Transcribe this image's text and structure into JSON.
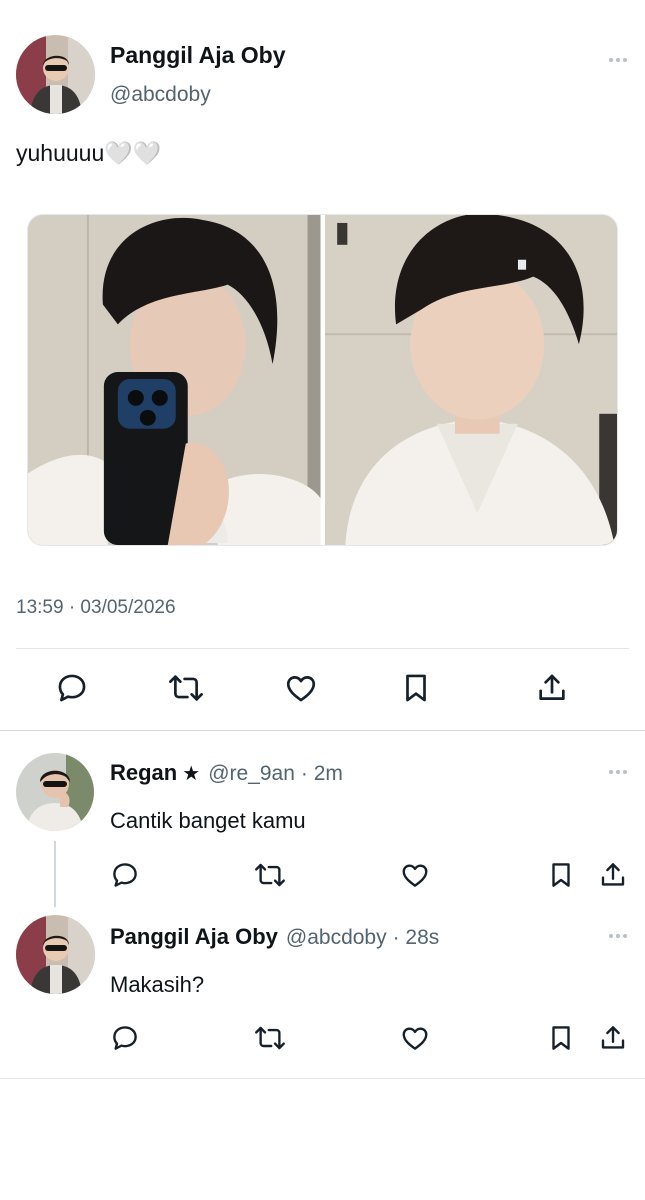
{
  "main_tweet": {
    "author_name": "Panggil Aja Oby",
    "author_handle": "@abcdoby",
    "text": "yuhuuuu🤍🤍",
    "timestamp": "13:59 · 03/05/2026",
    "media": [
      {
        "icon": "photo-selfie-phone"
      },
      {
        "icon": "photo-portrait"
      }
    ],
    "actions": [
      "reply-icon",
      "retweet-icon",
      "like-icon",
      "bookmark-icon",
      "share-icon"
    ]
  },
  "replies": [
    {
      "author_name": "Regan",
      "badge": "★",
      "author_handle": "@re_9an",
      "time": "· 2m",
      "text": "Cantik banget kamu"
    },
    {
      "author_name": "Panggil Aja Oby",
      "author_handle": "@abcdoby",
      "time": "· 28s",
      "text": "Makasih?"
    }
  ],
  "colors": {
    "text": "#0f1419",
    "secondary": "#536471",
    "divider": "#e3e6e9",
    "icon": "#16202a"
  }
}
